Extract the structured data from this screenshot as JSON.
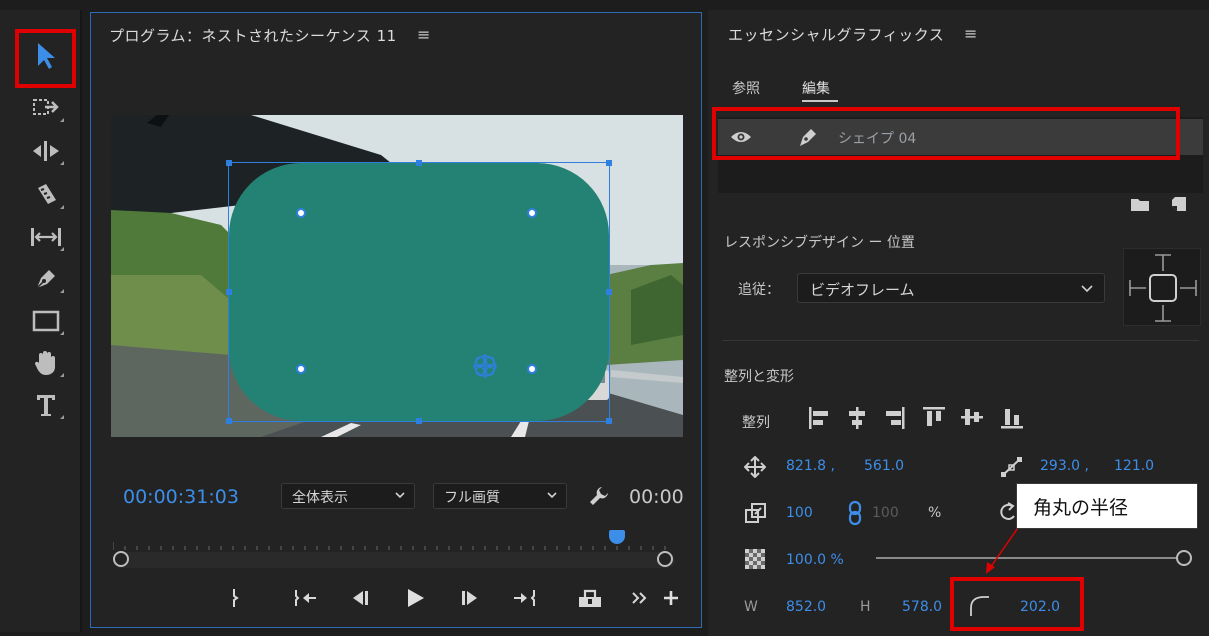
{
  "program_monitor": {
    "title": "プログラム：ネストされたシーケンス 11",
    "timecode": "00:00:31:03",
    "timecode_end": "00:00",
    "zoom_select": "全体表示",
    "quality_select": "フル画質"
  },
  "essential_graphics": {
    "title": "エッセンシャルグラフィックス",
    "tabs": [
      "参照",
      "編集"
    ],
    "active_tab": "編集",
    "layer": {
      "name": "シェイプ 04"
    },
    "responsive": {
      "title": "レスポンシブデザイン ー 位置",
      "follow_label": "追従：",
      "follow_value": "ビデオフレーム"
    },
    "align_transform": {
      "title": "整列と変形",
      "align_label": "整列",
      "position_x": "821.8 ,",
      "position_y": "561.0",
      "anchor_x": "293.0 ,",
      "anchor_y": "121.0",
      "scale": "100",
      "scale_linked": "100",
      "scale_unit": "%",
      "opacity": "100.0 %",
      "opacity_level": 1.0,
      "w_label": "W",
      "w_value": "852.0",
      "h_label": "H",
      "h_value": "578.0",
      "corner_radius": "202.0"
    }
  },
  "annotation": {
    "callout_text": "角丸の半径",
    "highlight_color": "#e00000"
  },
  "colors": {
    "accent_blue": "#3d8ee8",
    "shape_fill": "#248274",
    "panel_bg": "#232323"
  },
  "icons": [
    "selection-tool-icon",
    "track-select-icon",
    "ripple-edit-icon",
    "razor-icon",
    "slip-icon",
    "pen-icon",
    "rectangle-icon",
    "hand-icon",
    "type-icon",
    "eye-icon",
    "pen-layer-icon",
    "folder-icon",
    "new-layer-icon",
    "wrench-icon",
    "play-icon",
    "position-icon",
    "anchor-icon",
    "scale-icon",
    "link-icon",
    "rotation-icon",
    "opacity-icon",
    "corner-radius-icon"
  ]
}
